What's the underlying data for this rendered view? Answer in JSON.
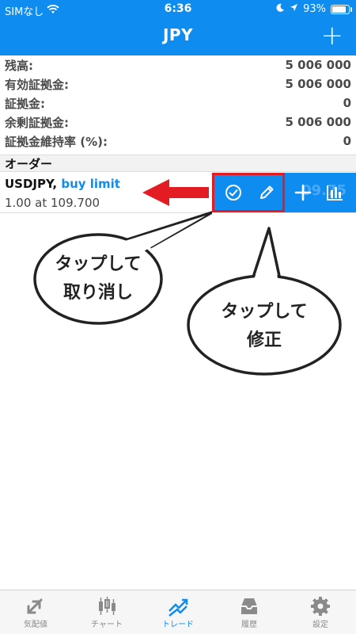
{
  "status_bar": {
    "carrier": "SIMなし",
    "time": "6:36",
    "battery": "93%",
    "battery_level": 0.93
  },
  "header": {
    "title": "JPY",
    "add_symbol": "+"
  },
  "summary": [
    {
      "label": "残高:",
      "value": "5 006 000"
    },
    {
      "label": "有効証拠金:",
      "value": "5 006 000"
    },
    {
      "label": "証拠金:",
      "value": "0"
    },
    {
      "label": "余剰証拠金:",
      "value": "5 006 000"
    },
    {
      "label": "証拠金維持率 (%):",
      "value": "0"
    }
  ],
  "orders": {
    "header": "オーダー",
    "item": {
      "symbol": "USDJPY,",
      "type": "buy limit",
      "detail": "1.00 at 109.700",
      "partial_price": "09.75"
    }
  },
  "annotations": {
    "cancel_bubble": {
      "line1": "タップして",
      "line2": "取り消し"
    },
    "modify_bubble": {
      "line1": "タップして",
      "line2": "修正"
    }
  },
  "tabs": [
    {
      "label": "気配値",
      "icon": "quotes-icon"
    },
    {
      "label": "チャート",
      "icon": "chart-icon"
    },
    {
      "label": "トレード",
      "icon": "trade-icon",
      "active": true
    },
    {
      "label": "履歴",
      "icon": "history-icon"
    },
    {
      "label": "設定",
      "icon": "settings-icon"
    }
  ],
  "colors": {
    "accent": "#0f8cf0",
    "highlight": "#e31b23"
  }
}
